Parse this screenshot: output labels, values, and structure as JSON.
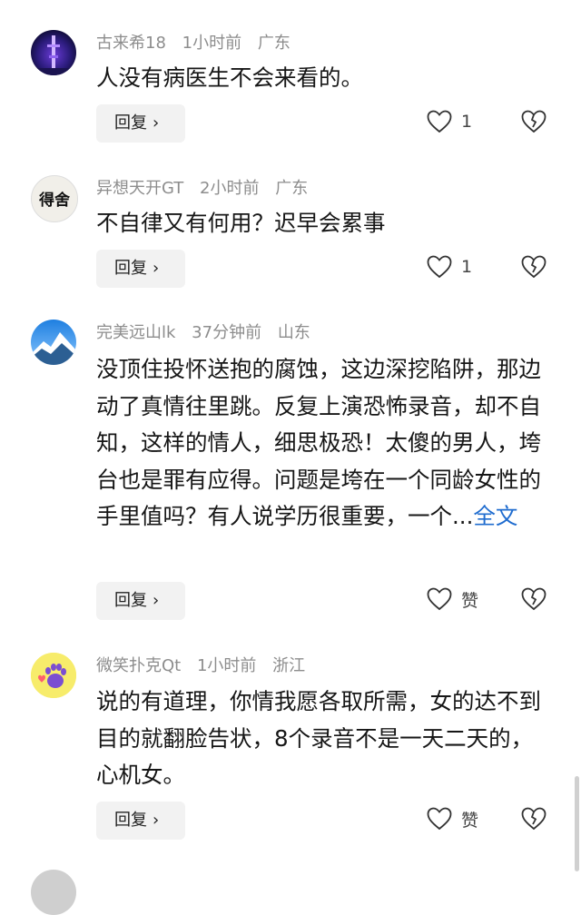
{
  "reply_label": "回复",
  "comments": [
    {
      "username": "古来希18",
      "time": "1小时前",
      "location": "广东",
      "text": "人没有病医生不会来看的。",
      "like_count": "1",
      "avatar_icon": "tower-night-avatar-icon"
    },
    {
      "username": "异想天开GT",
      "time": "2小时前",
      "location": "广东",
      "text": "不自律又有何用？迟早会累事",
      "like_count": "1",
      "avatar_icon": "calligraphy-avatar-icon",
      "avatar_text": "得舍"
    },
    {
      "username": "完美远山lk",
      "time": "37分钟前",
      "location": "山东",
      "text": "没顶住投怀送抱的腐蚀，这边深挖陷阱，那边动了真情往里跳。反复上演恐怖录音，却不自知，这样的情人，细思极恐！太傻的男人，垮台也是罪有应得。问题是垮在一个同龄女性的手里值吗？有人说学历很重要，一个...",
      "more_label": "全文",
      "like_count": "赞",
      "avatar_icon": "mountain-avatar-icon"
    },
    {
      "username": "微笑扑克Qt",
      "time": "1小时前",
      "location": "浙江",
      "text": "说的有道理，你情我愿各取所需，女的达不到目的就翻脸告状，8个录音不是一天二天的，心机女。",
      "like_count": "赞",
      "avatar_icon": "paw-avatar-icon"
    }
  ],
  "colors": {
    "meta_gray": "#8d8d8d",
    "link_blue": "#1f6ccf",
    "reply_bg": "#f2f2f2"
  }
}
